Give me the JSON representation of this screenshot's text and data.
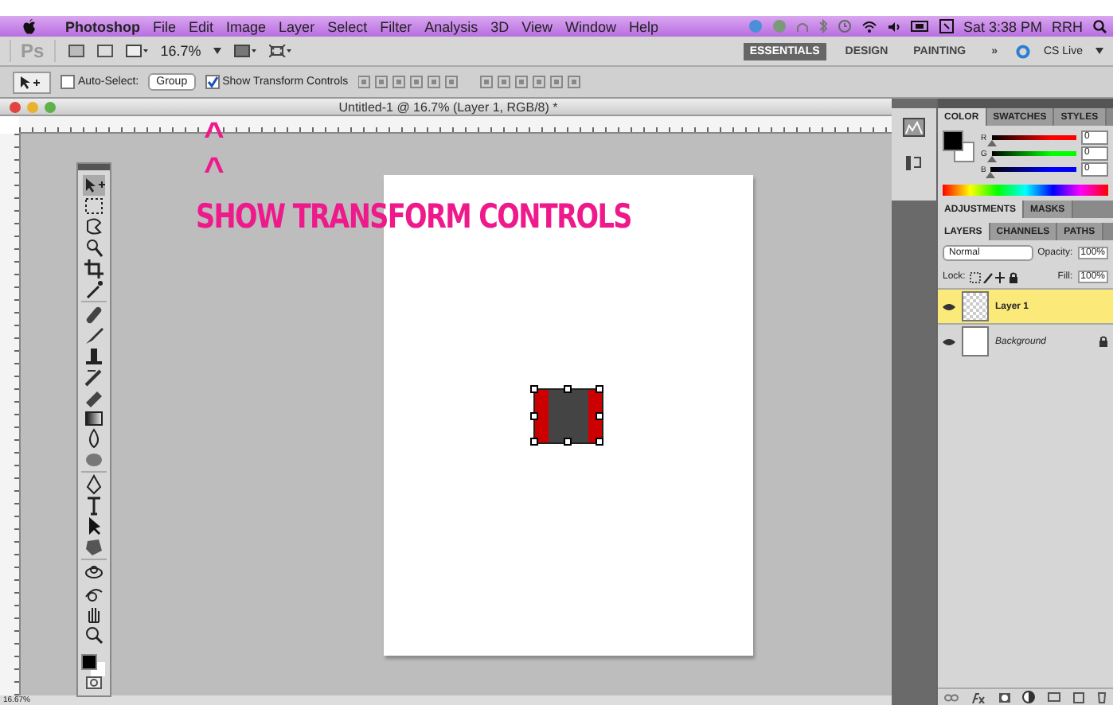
{
  "menu_bar": {
    "app_name": "Photoshop",
    "items": [
      "File",
      "Edit",
      "Image",
      "Layer",
      "Select",
      "Filter",
      "Analysis",
      "3D",
      "View",
      "Window",
      "Help"
    ],
    "clock": "Sat 3:38 PM",
    "user": "RRH"
  },
  "app_bar": {
    "logo": "Ps",
    "zoom": "16.7%",
    "workspaces": [
      {
        "label": "ESSENTIALS",
        "selected": true
      },
      {
        "label": "DESIGN",
        "selected": false
      },
      {
        "label": "PAINTING",
        "selected": false
      }
    ],
    "more": "»",
    "cs_live": "CS Live"
  },
  "options_bar": {
    "auto_select": {
      "label": "Auto-Select:",
      "checked": false
    },
    "target": "Group",
    "show_transform": {
      "label": "Show Transform Controls",
      "checked": true
    }
  },
  "document": {
    "title": "Untitled-1 @ 16.7% (Layer 1, RGB/8) *"
  },
  "annotation": {
    "carets": [
      "^",
      "^"
    ],
    "text": "SHOW TRANSFORM CONTROLS"
  },
  "color_panel": {
    "tabs": [
      {
        "label": "COLOR",
        "selected": true
      },
      {
        "label": "SWATCHES",
        "selected": false
      },
      {
        "label": "STYLES",
        "selected": false
      }
    ],
    "sliders": [
      {
        "label": "R",
        "value": "0",
        "level": 0,
        "color": "#ff0000"
      },
      {
        "label": "G",
        "value": "0",
        "level": 0,
        "color": "#00ff00"
      },
      {
        "label": "B",
        "value": "0",
        "level": 0,
        "color": "#0000ff"
      }
    ]
  },
  "adjustments_panel": {
    "tabs": [
      {
        "label": "ADJUSTMENTS",
        "selected": true
      },
      {
        "label": "MASKS",
        "selected": false
      }
    ]
  },
  "layers_panel": {
    "tabs": [
      {
        "label": "LAYERS",
        "selected": true
      },
      {
        "label": "CHANNELS",
        "selected": false
      },
      {
        "label": "PATHS",
        "selected": false
      }
    ],
    "blend_mode": "Normal",
    "opacity_label": "Opacity:",
    "opacity": "100%",
    "lock_label": "Lock:",
    "fill_label": "Fill:",
    "fill": "100%",
    "layers": [
      {
        "name": "Layer 1",
        "kind": "transparent",
        "selected": true,
        "visible": true,
        "locked": false
      },
      {
        "name": "Background",
        "kind": "background",
        "selected": false,
        "visible": true,
        "locked": true
      }
    ]
  },
  "status_bar": {
    "zoom": "16.67%"
  }
}
